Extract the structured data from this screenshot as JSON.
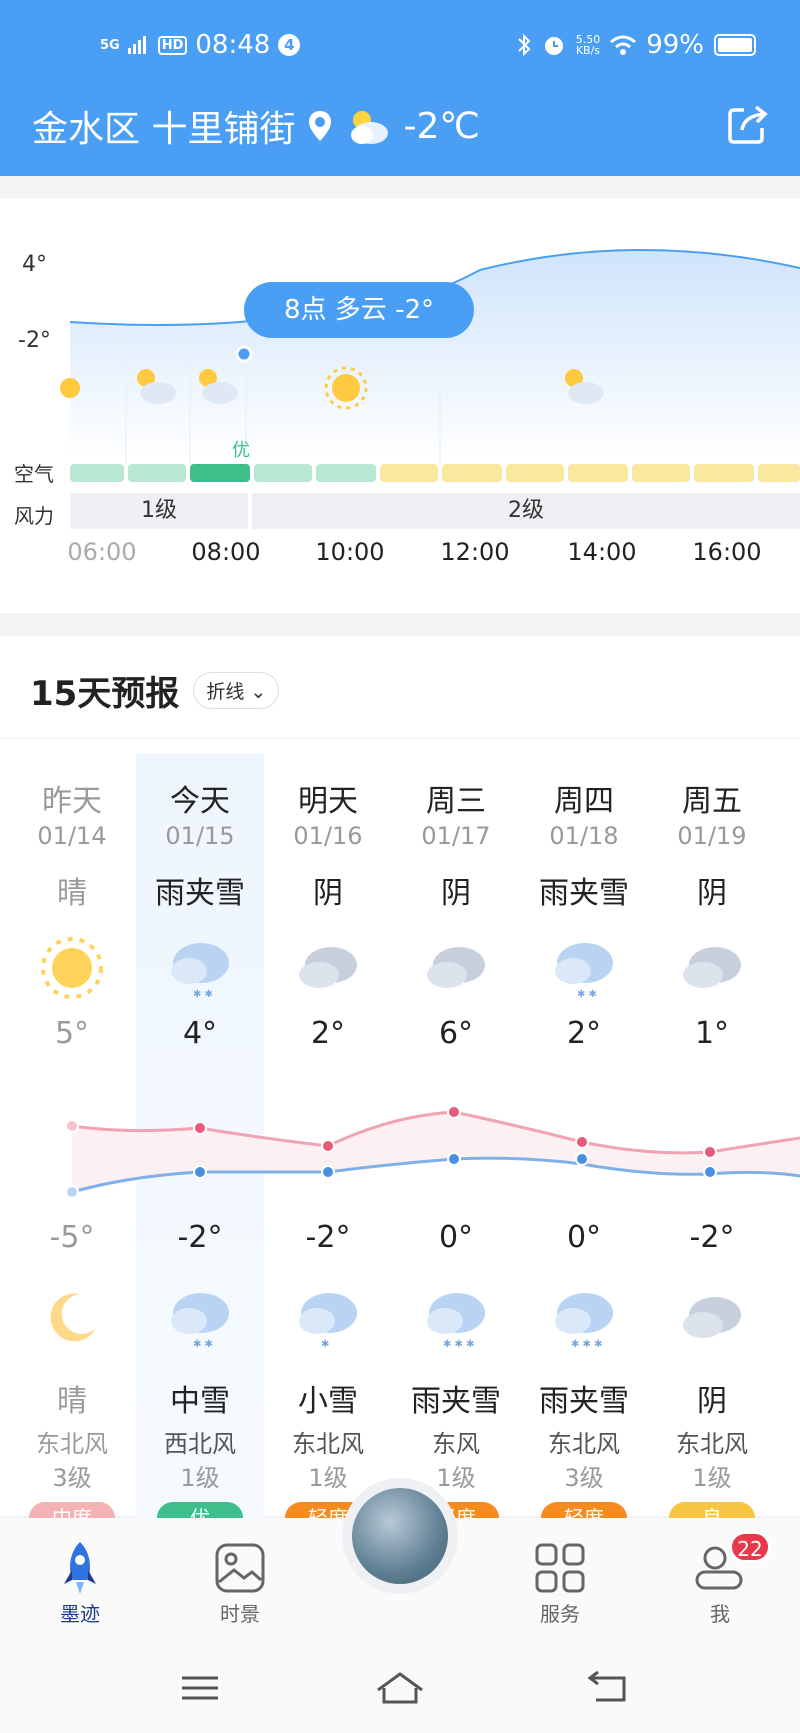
{
  "status_bar": {
    "signal": "5G",
    "hd": "HD",
    "time": "08:48",
    "notif_count": "4",
    "speed_value": "5.50",
    "speed_unit": "KB/s",
    "battery": "99%"
  },
  "header": {
    "location": "金水区 十里铺街",
    "temperature": "-2℃"
  },
  "hourly": {
    "tooltip": "8点 多云 -2°",
    "y_top": "4°",
    "y_mid": "-2°",
    "air_label": "空气",
    "wind_label": "风力",
    "air_quality_text": "优",
    "wind_levels": [
      "1级",
      "2级"
    ],
    "hours": [
      "06:00",
      "08:00",
      "10:00",
      "12:00",
      "14:00",
      "16:00"
    ]
  },
  "forecast": {
    "title": "15天预报",
    "mode": "折线",
    "days": [
      {
        "day": "昨天",
        "date": "01/14",
        "cond_day": "晴",
        "hi": "5°",
        "lo": "-5°",
        "cond_night": "晴",
        "wind_dir": "东北风",
        "wind_level": "3级",
        "aq": "中度"
      },
      {
        "day": "今天",
        "date": "01/15",
        "cond_day": "雨夹雪",
        "hi": "4°",
        "lo": "-2°",
        "cond_night": "中雪",
        "wind_dir": "西北风",
        "wind_level": "1级",
        "aq": "优"
      },
      {
        "day": "明天",
        "date": "01/16",
        "cond_day": "阴",
        "hi": "2°",
        "lo": "-2°",
        "cond_night": "小雪",
        "wind_dir": "东北风",
        "wind_level": "1级",
        "aq": "轻度"
      },
      {
        "day": "周三",
        "date": "01/17",
        "cond_day": "阴",
        "hi": "6°",
        "lo": "0°",
        "cond_night": "雨夹雪",
        "wind_dir": "东风",
        "wind_level": "1级",
        "aq": "轻度"
      },
      {
        "day": "周四",
        "date": "01/18",
        "cond_day": "雨夹雪",
        "hi": "2°",
        "lo": "0°",
        "cond_night": "雨夹雪",
        "wind_dir": "东北风",
        "wind_level": "3级",
        "aq": "轻度"
      },
      {
        "day": "周五",
        "date": "01/19",
        "cond_day": "阴",
        "hi": "1°",
        "lo": "-2°",
        "cond_night": "阴",
        "wind_dir": "东北风",
        "wind_level": "1级",
        "aq": "良"
      }
    ]
  },
  "tabbar": {
    "items": [
      "墨迹",
      "时景",
      "服务",
      "我"
    ],
    "badge": "22"
  },
  "colors": {
    "primary": "#4a9ff4",
    "hi_line": "#e85a7a",
    "lo_line": "#4a90e2",
    "aq_good": "#3cbf8a",
    "aq_fair": "#f6c544",
    "aq_light": "#f58a1f",
    "aq_moderate": "#ef8a8a"
  }
}
